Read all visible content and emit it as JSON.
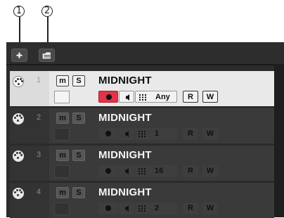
{
  "callouts": [
    {
      "label": "1"
    },
    {
      "label": "2"
    }
  ],
  "toolbar": {
    "add_track_icon": "plus-icon",
    "track_presets_icon": "track-presets-icon"
  },
  "tracks": [
    {
      "number": "1",
      "name": "MIDNIGHT",
      "mute": "m",
      "solo": "S",
      "channel": "Any",
      "read": "R",
      "write": "W",
      "selected": true
    },
    {
      "number": "2",
      "name": "MIDNIGHT",
      "mute": "m",
      "solo": "S",
      "channel": "1",
      "read": "R",
      "write": "W",
      "selected": false
    },
    {
      "number": "3",
      "name": "MIDNIGHT",
      "mute": "m",
      "solo": "S",
      "channel": "16",
      "read": "R",
      "write": "W",
      "selected": false
    },
    {
      "number": "4",
      "name": "MIDNIGHT",
      "mute": "m",
      "solo": "S",
      "channel": "2",
      "read": "R",
      "write": "W",
      "selected": false
    }
  ],
  "colors": {
    "record_active": "#e2334a",
    "panel_dark": "#2b2b2b",
    "track_selected": "#e9e9e9"
  }
}
